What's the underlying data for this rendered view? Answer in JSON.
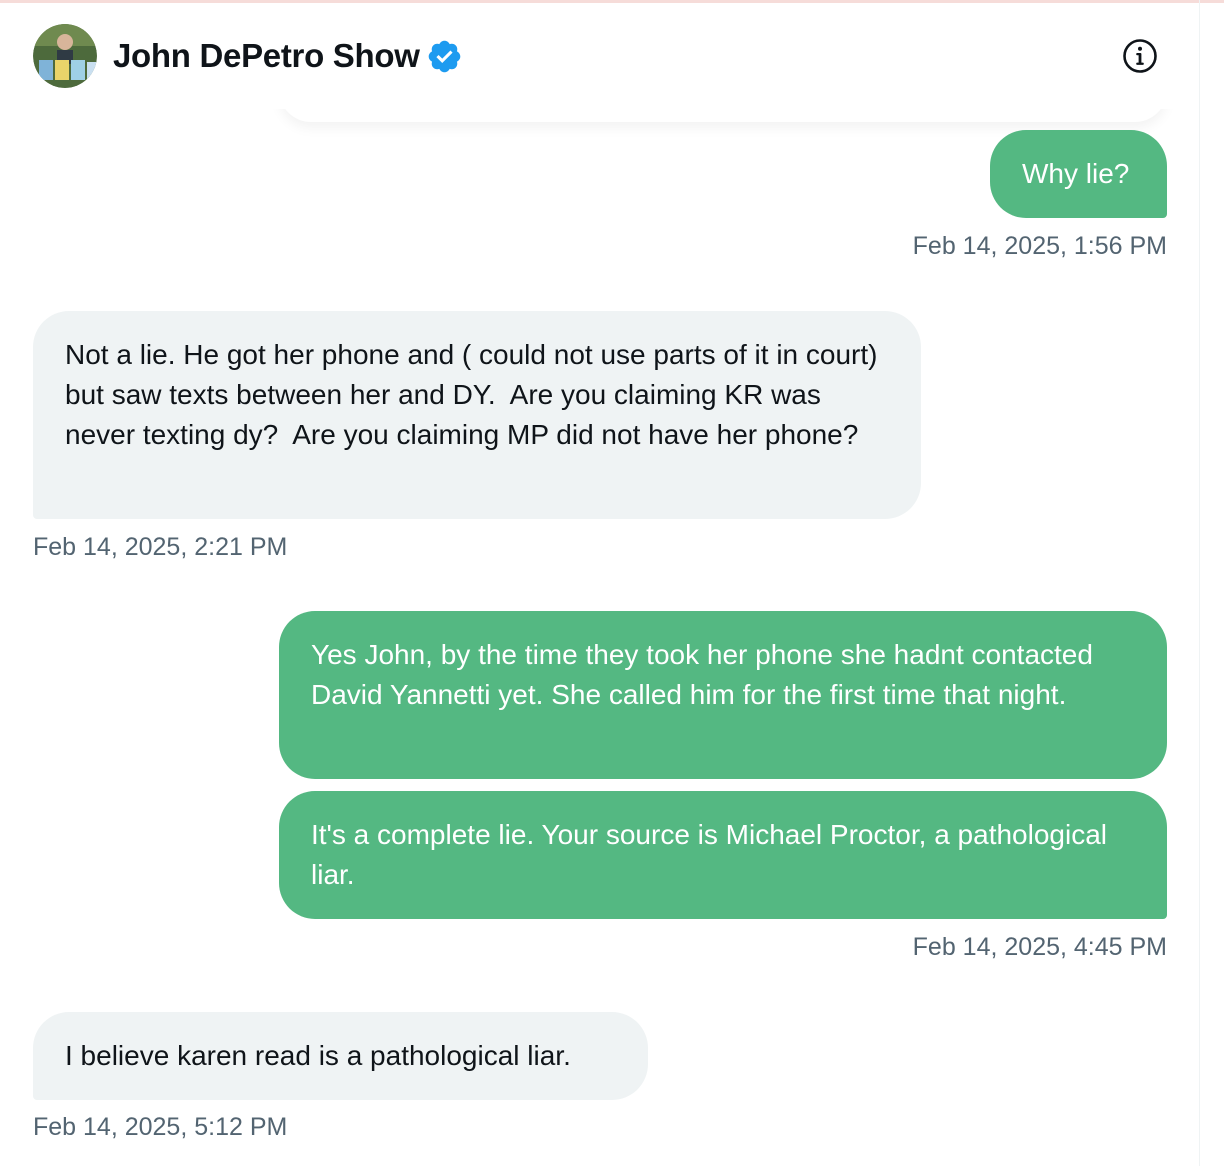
{
  "header": {
    "name": "John DePetro Show",
    "verified_icon": "verified-badge-icon",
    "info_icon": "info-icon"
  },
  "colors": {
    "sent_bubble": "#54b882",
    "received_bubble": "#eff3f4",
    "verified": "#1d9bf0",
    "timestamp": "#536471"
  },
  "messages": [
    {
      "direction": "sent",
      "text": "Why lie?",
      "timestamp": "Feb 14, 2025, 1:56 PM"
    },
    {
      "direction": "received",
      "text": "Not a lie. He got her phone and ( could not use parts of it in court) but saw texts between her and DY.  Are you claiming KR was never texting dy?  Are you claiming MP did not have her phone?",
      "timestamp": "Feb 14, 2025, 2:21 PM"
    },
    {
      "direction": "sent",
      "text": "Yes John, by the time they took her phone she hadnt contacted David Yannetti yet. She called him for the first time that night.",
      "timestamp": ""
    },
    {
      "direction": "sent",
      "text": "It's a complete lie. Your source is Michael Proctor, a pathological liar.",
      "timestamp": "Feb 14, 2025, 4:45 PM"
    },
    {
      "direction": "received",
      "text": "I believe karen read is a pathological liar.",
      "timestamp": "Feb 14, 2025, 5:12 PM"
    }
  ]
}
